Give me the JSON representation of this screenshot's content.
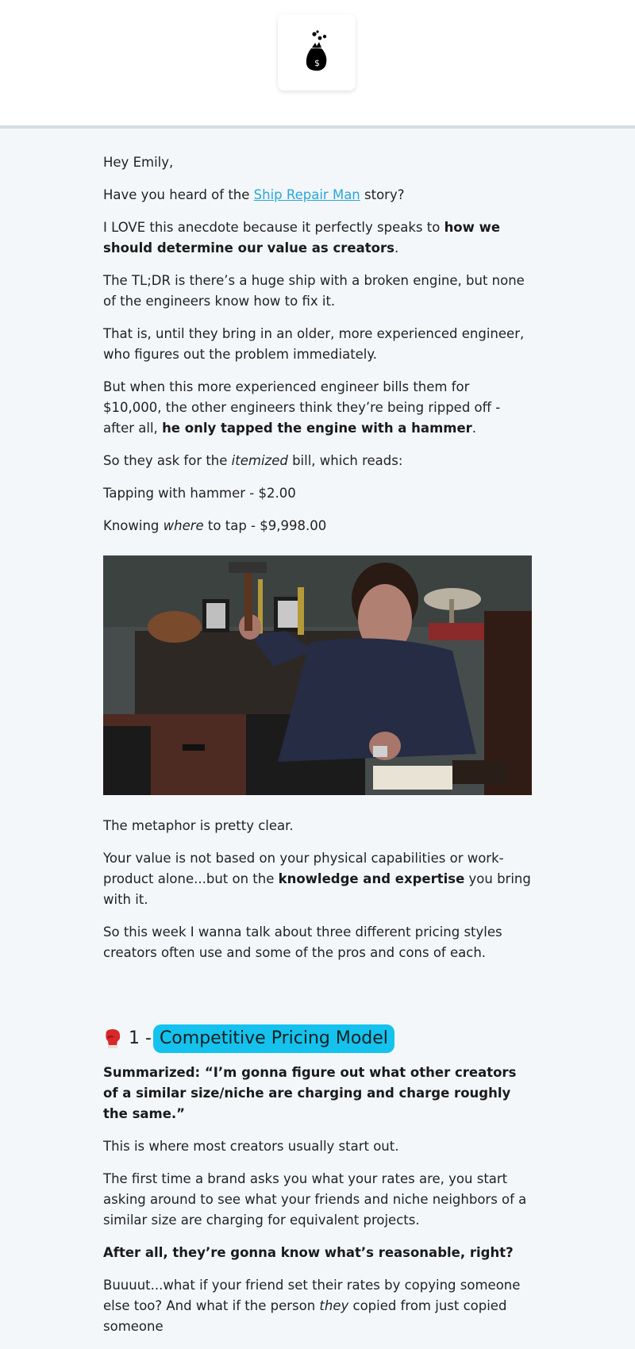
{
  "header": {
    "logo": "money-bag-icon"
  },
  "email": {
    "greeting": "Hey Emily,",
    "p1_pre": "Have you heard of the ",
    "p1_link": "Ship Repair Man",
    "p1_post": " story?",
    "p2_pre": "I LOVE this anecdote because it perfectly speaks to ",
    "p2_bold": "how we should determine our value as creators",
    "p2_post": ".",
    "p3": "The TL;DR is there’s a huge ship with a broken engine, but none of the engineers know how to fix it.",
    "p4": "That is, until they bring in an older, more experienced engineer, who figures out the problem immediately.",
    "p5_pre": "But when this more experienced engineer bills them for $10,000, the other engineers think they’re being ripped off - after all, ",
    "p5_bold": "he only tapped the engine with a hammer",
    "p5_post": ".",
    "p6_pre": "So they ask for the ",
    "p6_italic": "itemized",
    "p6_post": " bill, which reads:",
    "p7": "Tapping with hammer - $2.00",
    "p8_pre": "Knowing ",
    "p8_italic": "where",
    "p8_post": " to tap - $9,998.00",
    "p9": "The metaphor is pretty clear.",
    "p10_pre": "Your value is not based on your physical capabilities or work-product alone...but on the ",
    "p10_bold": "knowledge and expertise",
    "p10_post": " you bring with it.",
    "p11": "So this week I wanna talk about three different pricing styles creators often use and some of the pros and cons of each.",
    "section1": {
      "icon": "boxing-glove-icon",
      "number": "1 -",
      "title": "Competitive Pricing Model",
      "accent": "#15c2ee"
    },
    "s1_summary": "Summarized: “I’m gonna figure out what other creators of a similar size/niche are charging and charge roughly the same.”",
    "s1_p1": "This is where most creators usually start out.",
    "s1_p2": "The first time a brand asks you what your rates are, you start asking around to see what your friends and niche neighbors of a similar size are charging for equivalent projects.",
    "s1_p3": "After all, they’re gonna know what’s reasonable, right?",
    "s1_p4_pre": "Buuuut...what if your friend set their rates by copying someone else too? And what if the person ",
    "s1_p4_italic": "they",
    "s1_p4_post": " copied from just copied someone"
  },
  "colors": {
    "link": "#2aa7d8",
    "background": "#f4f7fa"
  }
}
